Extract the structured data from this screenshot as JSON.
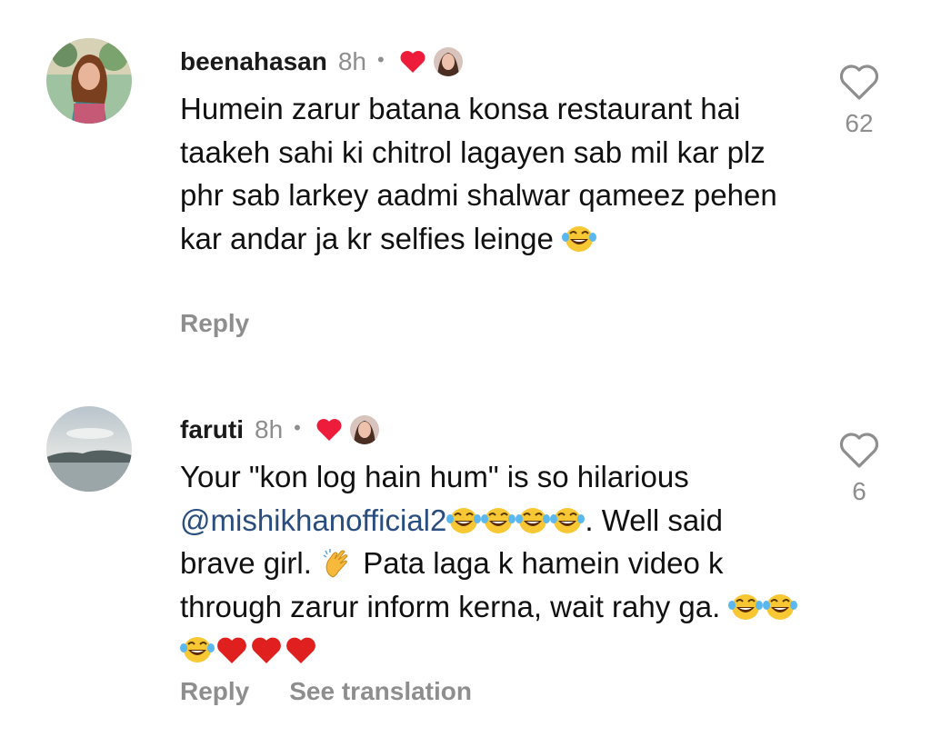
{
  "comments": [
    {
      "username": "beenahasan",
      "time": "8h",
      "separator": "•",
      "body": [
        {
          "text": "Humein zarur batana konsa restaurant hai taakeh sahi ki chitrol lagayen sab mil kar plz phr sab larkey aadmi shalwar qameez pehen kar andar ja kr selfies leinge "
        }
      ],
      "like_count": "62",
      "actions": [
        "Reply"
      ]
    },
    {
      "username": "faruti",
      "time": "8h",
      "separator": "•",
      "body_parts": {
        "p1": "Your \"kon log hain hum\" is so hilarious ",
        "mention": "@mishikhanofficial2",
        "p2": ". Well said brave girl. ",
        "p3": " Pata laga k hamein video k through zarur inform kerna, wait rahy ga. "
      },
      "like_count": "6",
      "actions": [
        "Reply",
        "See translation"
      ]
    }
  ],
  "icons": {
    "heart_outline": "heart-outline-icon",
    "creator_heart": "red-heart-icon",
    "laughing": "face-with-tears-of-joy-emoji",
    "clapping": "clapping-hands-emoji",
    "red_heart_emoji": "red-heart-emoji"
  },
  "colors": {
    "mention": "#2a4d7f",
    "muted": "#8e8e8e",
    "heart_red": "#ed4956"
  }
}
